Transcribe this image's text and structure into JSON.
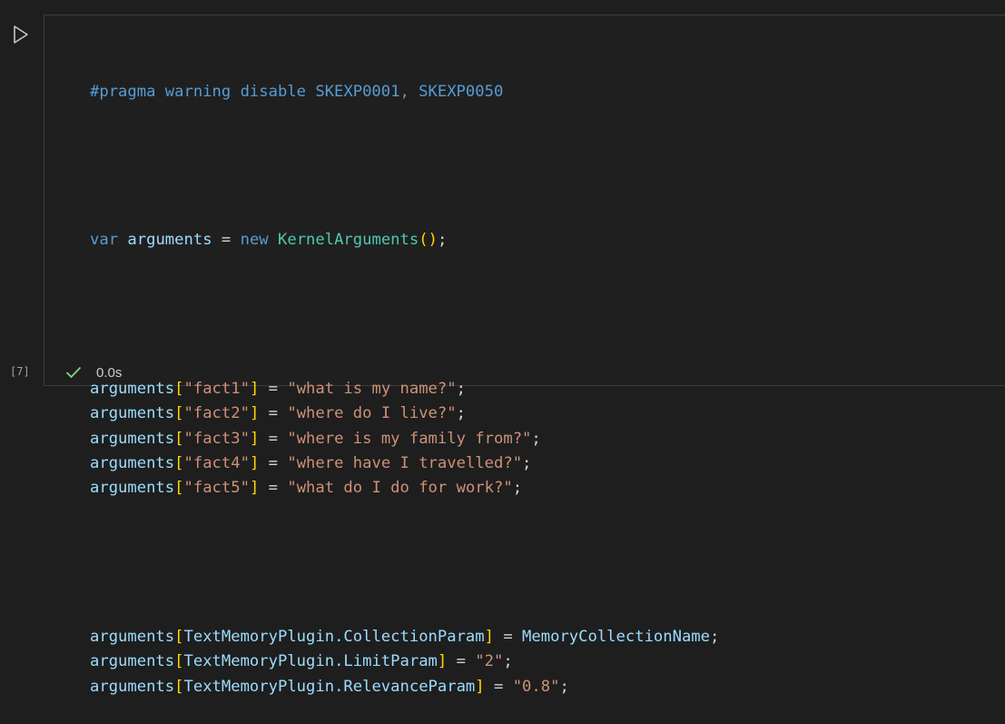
{
  "cell": {
    "execution_count": "[7]",
    "duration": "0.0s",
    "run_icon": "play-icon",
    "status_icon": "check-icon",
    "status_color": "#89d185"
  },
  "code": {
    "pragma": "#pragma warning disable SKEXP0001, SKEXP0050",
    "line3": {
      "kw_var": "var",
      "name": "arguments",
      "eq": " = ",
      "kw_new": "new",
      "type": "KernelArguments",
      "open": "(",
      "close": ")",
      "end": ";"
    },
    "facts": [
      {
        "var": "arguments",
        "key": "\"fact1\"",
        "value": "\"what is my name?\""
      },
      {
        "var": "arguments",
        "key": "\"fact2\"",
        "value": "\"where do I live?\""
      },
      {
        "var": "arguments",
        "key": "\"fact3\"",
        "value": "\"where is my family from?\""
      },
      {
        "var": "arguments",
        "key": "\"fact4\"",
        "value": "\"where have I travelled?\""
      },
      {
        "var": "arguments",
        "key": "\"fact5\"",
        "value": "\"what do I do for work?\""
      }
    ],
    "params": [
      {
        "var": "arguments",
        "param": "TextMemoryPlugin.CollectionParam",
        "value": "MemoryCollectionName",
        "is_string": false
      },
      {
        "var": "arguments",
        "param": "TextMemoryPlugin.LimitParam",
        "value": "\"2\"",
        "is_string": true
      },
      {
        "var": "arguments",
        "param": "TextMemoryPlugin.RelevanceParam",
        "value": "\"0.8\"",
        "is_string": true
      }
    ],
    "sym": {
      "lb": "[",
      "rb": "]",
      "eq": " = ",
      "semi": ";"
    }
  }
}
